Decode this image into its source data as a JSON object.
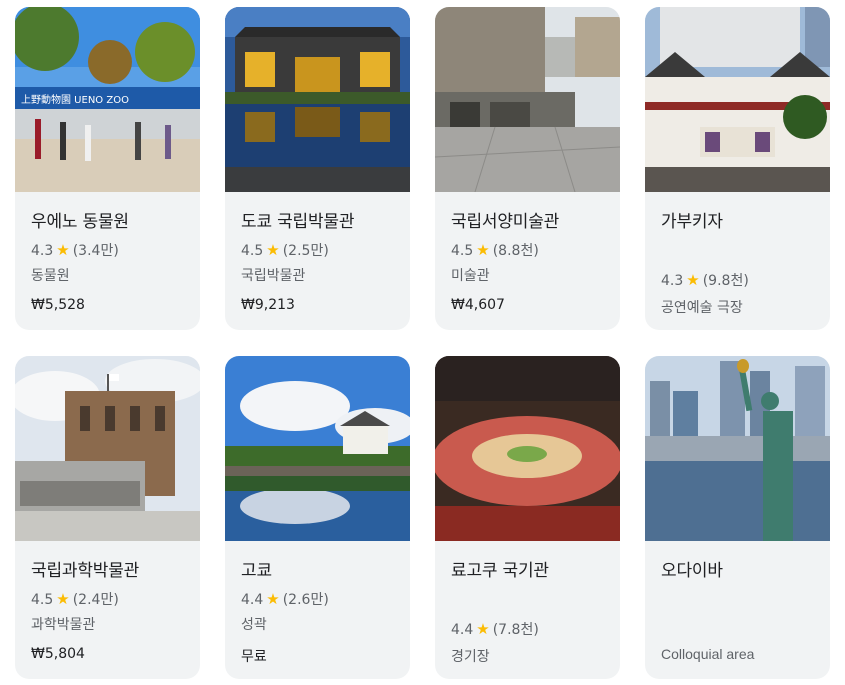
{
  "colors": {
    "card_bg": "#f1f3f4",
    "star": "#fbbc04",
    "title": "#202124",
    "meta": "#5f6368"
  },
  "cards": [
    {
      "title": "우에노 동물원",
      "rating": "4.3",
      "reviews": "(3.4만)",
      "category": "동물원",
      "price": "₩5,528",
      "sign": "上野動物園 UENO ZOO",
      "image_icon": "zoo-entrance-photo"
    },
    {
      "title": "도쿄 국립박물관",
      "rating": "4.5",
      "reviews": "(2.5만)",
      "category": "국립박물관",
      "price": "₩9,213",
      "image_icon": "museum-reflection-photo"
    },
    {
      "title": "국립서양미술관",
      "rating": "4.5",
      "reviews": "(8.8천)",
      "category": "미술관",
      "price": "₩4,607",
      "image_icon": "modern-museum-photo"
    },
    {
      "title": "가부키자",
      "rating": "4.3",
      "reviews": "(9.8천)",
      "category": "공연예술 극장",
      "image_icon": "kabuki-theater-photo"
    },
    {
      "title": "국립과학박물관",
      "rating": "4.5",
      "reviews": "(2.4만)",
      "category": "과학박물관",
      "price": "₩5,804",
      "image_icon": "science-museum-photo"
    },
    {
      "title": "고쿄",
      "rating": "4.4",
      "reviews": "(2.6만)",
      "category": "성곽",
      "price": "무료",
      "image_icon": "imperial-palace-photo"
    },
    {
      "title": "료고쿠 국기관",
      "rating": "4.4",
      "reviews": "(7.8천)",
      "category": "경기장",
      "image_icon": "sumo-arena-photo"
    },
    {
      "title": "오다이바",
      "category": "Colloquial area",
      "image_icon": "statue-of-liberty-photo"
    }
  ]
}
